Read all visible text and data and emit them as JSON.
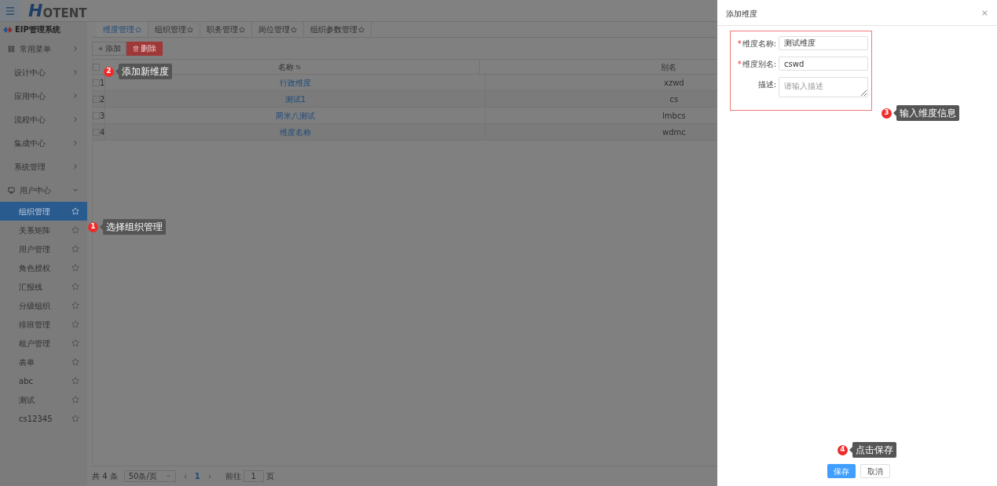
{
  "header": {
    "logo": "OTENT",
    "logo_initial": "H"
  },
  "sidebar": {
    "title": "EIP管理系统",
    "items": [
      {
        "label": "常用菜单",
        "kind": "grid",
        "expanded": false
      },
      {
        "label": "设计中心",
        "kind": "plain",
        "expanded": false
      },
      {
        "label": "应用中心",
        "kind": "plain",
        "expanded": false
      },
      {
        "label": "流程中心",
        "kind": "plain",
        "expanded": false
      },
      {
        "label": "集成中心",
        "kind": "plain",
        "expanded": false
      },
      {
        "label": "系统管理",
        "kind": "plain",
        "expanded": false
      },
      {
        "label": "用户中心",
        "kind": "monitor",
        "expanded": true,
        "children": [
          {
            "label": "组织管理",
            "selected": true
          },
          {
            "label": "关系矩阵",
            "selected": false
          },
          {
            "label": "用户管理",
            "selected": false
          },
          {
            "label": "角色授权",
            "selected": false
          },
          {
            "label": "汇报线",
            "selected": false
          },
          {
            "label": "分级组织",
            "selected": false
          },
          {
            "label": "排班管理",
            "selected": false
          },
          {
            "label": "租户管理",
            "selected": false
          },
          {
            "label": "表单",
            "selected": false
          },
          {
            "label": "abc",
            "selected": false
          },
          {
            "label": "测试",
            "selected": false
          },
          {
            "label": "cs12345",
            "selected": false
          }
        ]
      }
    ]
  },
  "tabs": [
    {
      "label": "维度管理",
      "selected": true
    },
    {
      "label": "组织管理",
      "selected": false
    },
    {
      "label": "职务管理",
      "selected": false
    },
    {
      "label": "岗位管理",
      "selected": false
    },
    {
      "label": "组织参数管理",
      "selected": false
    }
  ],
  "toolbar": {
    "add": "添加",
    "delete": "删除"
  },
  "table": {
    "columns": [
      "名称",
      "别名"
    ],
    "all_checked": false,
    "rows": [
      {
        "index": "1",
        "name": "行政维度",
        "alias": "xzwd",
        "checked": false
      },
      {
        "index": "2",
        "name": "测试1",
        "alias": "cs",
        "checked": false
      },
      {
        "index": "3",
        "name": "两米八测试",
        "alias": "lmbcs",
        "checked": false
      },
      {
        "index": "4",
        "name": "维度名称",
        "alias": "wdmc",
        "checked": false
      }
    ]
  },
  "pagination": {
    "total": "共 4 条",
    "page_size": "50条/页",
    "current": "1",
    "goto": "前往",
    "goto_value": "1",
    "page_unit": "页"
  },
  "drawer": {
    "title": "添加维度",
    "close": "×",
    "required_mark": "*",
    "fields": [
      {
        "label": "维度名称:",
        "required": true,
        "kind": "input",
        "value": "测试维度"
      },
      {
        "label": "维度别名:",
        "required": true,
        "kind": "input",
        "value": "cswd"
      },
      {
        "label": "描述:",
        "required": false,
        "kind": "textarea",
        "placeholder": "请输入描述"
      }
    ],
    "buttons": [
      {
        "label": "保存",
        "kind": "primary"
      },
      {
        "label": "取消",
        "kind": "default"
      }
    ]
  },
  "callouts": [
    {
      "number": "2",
      "text": "添加新维度"
    },
    {
      "number": "3",
      "text": "输入维度信息"
    },
    {
      "number": "1",
      "text": "选择组织管理"
    },
    {
      "number": "4",
      "text": "点击保存"
    }
  ]
}
